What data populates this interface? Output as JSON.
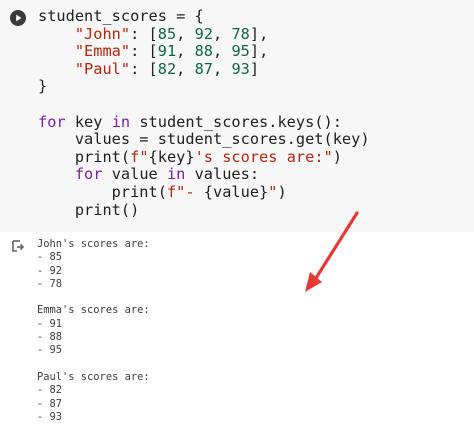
{
  "code_cell": {
    "run_button_icon": "play-circle-icon",
    "lines": [
      {
        "segments": [
          {
            "t": "student_scores = {",
            "c": "pn"
          }
        ]
      },
      {
        "segments": [
          {
            "t": "    ",
            "c": "pn"
          },
          {
            "t": "\"John\"",
            "c": "str"
          },
          {
            "t": ": [",
            "c": "pn"
          },
          {
            "t": "85",
            "c": "num"
          },
          {
            "t": ", ",
            "c": "pn"
          },
          {
            "t": "92",
            "c": "num"
          },
          {
            "t": ", ",
            "c": "pn"
          },
          {
            "t": "78",
            "c": "num"
          },
          {
            "t": "],",
            "c": "pn"
          }
        ]
      },
      {
        "segments": [
          {
            "t": "    ",
            "c": "pn"
          },
          {
            "t": "\"Emma\"",
            "c": "str"
          },
          {
            "t": ": [",
            "c": "pn"
          },
          {
            "t": "91",
            "c": "num"
          },
          {
            "t": ", ",
            "c": "pn"
          },
          {
            "t": "88",
            "c": "num"
          },
          {
            "t": ", ",
            "c": "pn"
          },
          {
            "t": "95",
            "c": "num"
          },
          {
            "t": "],",
            "c": "pn"
          }
        ]
      },
      {
        "segments": [
          {
            "t": "    ",
            "c": "pn"
          },
          {
            "t": "\"Paul\"",
            "c": "str"
          },
          {
            "t": ": [",
            "c": "pn"
          },
          {
            "t": "82",
            "c": "num"
          },
          {
            "t": ", ",
            "c": "pn"
          },
          {
            "t": "87",
            "c": "num"
          },
          {
            "t": ", ",
            "c": "pn"
          },
          {
            "t": "93",
            "c": "num"
          },
          {
            "t": "]",
            "c": "pn"
          }
        ]
      },
      {
        "segments": [
          {
            "t": "}",
            "c": "pn"
          }
        ]
      },
      {
        "segments": []
      },
      {
        "segments": [
          {
            "t": "for",
            "c": "kw"
          },
          {
            "t": " key ",
            "c": "pn"
          },
          {
            "t": "in",
            "c": "kw"
          },
          {
            "t": " student_scores.keys():",
            "c": "pn"
          }
        ]
      },
      {
        "segments": [
          {
            "t": "    values = student_scores.get(key)",
            "c": "pn"
          }
        ]
      },
      {
        "segments": [
          {
            "t": "    print(",
            "c": "pn"
          },
          {
            "t": "f\"",
            "c": "str"
          },
          {
            "t": "{key}",
            "c": "pn"
          },
          {
            "t": "'s scores are:\"",
            "c": "str"
          },
          {
            "t": ")",
            "c": "pn"
          }
        ]
      },
      {
        "segments": [
          {
            "t": "    ",
            "c": "pn"
          },
          {
            "t": "for",
            "c": "kw"
          },
          {
            "t": " value ",
            "c": "pn"
          },
          {
            "t": "in",
            "c": "kw"
          },
          {
            "t": " values:",
            "c": "pn"
          }
        ]
      },
      {
        "segments": [
          {
            "t": "        print(",
            "c": "pn"
          },
          {
            "t": "f\"- ",
            "c": "str"
          },
          {
            "t": "{value}",
            "c": "pn"
          },
          {
            "t": "\"",
            "c": "str"
          },
          {
            "t": ")",
            "c": "pn"
          }
        ]
      },
      {
        "segments": [
          {
            "t": "    print()",
            "c": "pn"
          }
        ]
      }
    ]
  },
  "output": {
    "icon": "output-redirect-icon",
    "lines": [
      "John's scores are:",
      "- 85",
      "- 92",
      "- 78",
      "",
      "Emma's scores are:",
      "- 91",
      "- 88",
      "- 95",
      "",
      "Paul's scores are:",
      "- 82",
      "- 87",
      "- 93"
    ]
  },
  "annotation": {
    "arrow_color": "#e53935"
  }
}
